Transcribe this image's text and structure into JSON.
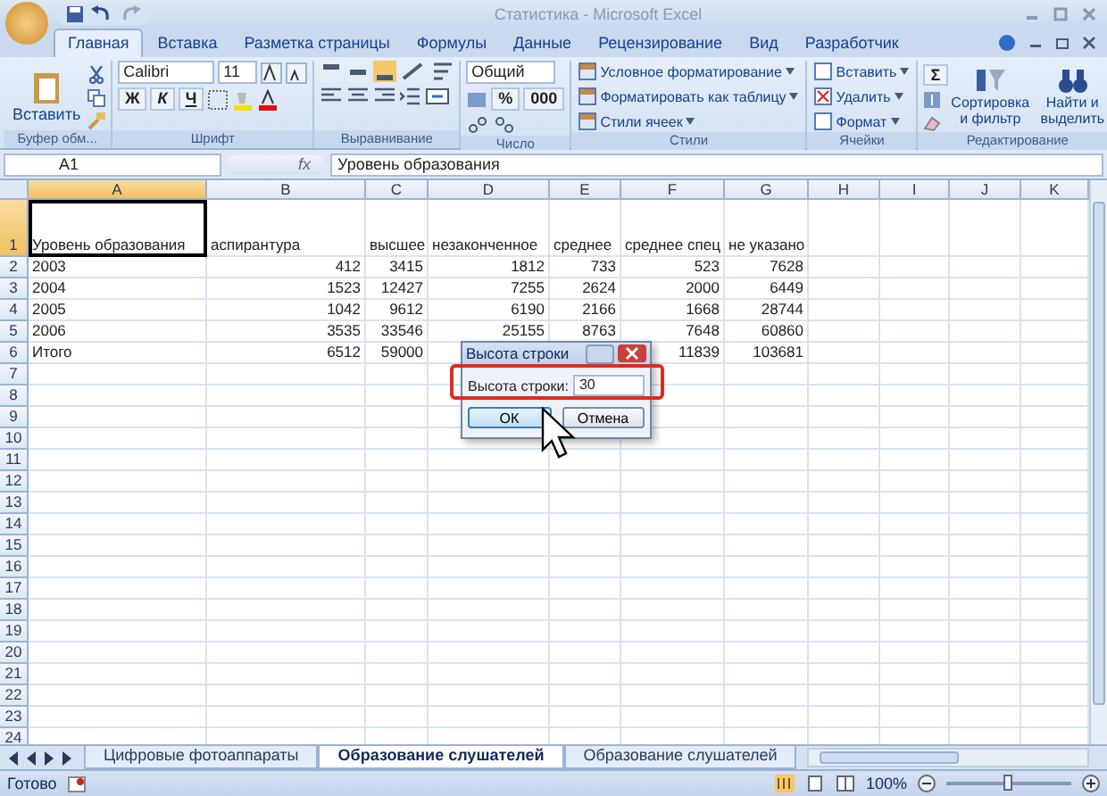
{
  "window": {
    "title": "Статистика - Microsoft Excel"
  },
  "ribbon_tabs": [
    {
      "label": "Главная",
      "selected": true
    },
    {
      "label": "Вставка",
      "selected": false
    },
    {
      "label": "Разметка страницы",
      "selected": false
    },
    {
      "label": "Формулы",
      "selected": false
    },
    {
      "label": "Данные",
      "selected": false
    },
    {
      "label": "Рецензирование",
      "selected": false
    },
    {
      "label": "Вид",
      "selected": false
    },
    {
      "label": "Разработчик",
      "selected": false
    }
  ],
  "ribbon": {
    "clipboard": {
      "paste": "Вставить",
      "label": "Буфер обм..."
    },
    "font": {
      "name": "Calibri",
      "size": "11",
      "styles": [
        "Ж",
        "К",
        "Ч"
      ],
      "label": "Шрифт"
    },
    "alignment": {
      "label": "Выравнивание"
    },
    "number": {
      "format": "Общий",
      "symbols": [
        "%",
        "000"
      ],
      "label": "Число"
    },
    "styles": {
      "items": [
        "Условное форматирование",
        "Форматировать как таблицу",
        "Стили ячеек"
      ],
      "label": "Стили"
    },
    "cells": {
      "items": [
        "Вставить",
        "Удалить",
        "Формат"
      ],
      "label": "Ячейки"
    },
    "editing": {
      "sigma": "Σ",
      "buttons": [
        "Сортировка и фильтр",
        "Найти и выделить"
      ],
      "label": "Редактирование"
    }
  },
  "formula_bar": {
    "name_box": "A1",
    "fx": "fx",
    "value": "Уровень образования"
  },
  "sheet": {
    "columns": [
      "A",
      "B",
      "C",
      "D",
      "E",
      "F",
      "G",
      "H",
      "I",
      "J",
      "K"
    ],
    "rows": [
      {
        "label": "1",
        "cells": [
          "Уровень образования",
          "аспирантура",
          "высшее",
          "незаконченное",
          "среднее",
          "среднее спец",
          "не указано"
        ]
      },
      {
        "label": "2",
        "cells": [
          "2003",
          "412",
          "3415",
          "1812",
          "733",
          "523",
          "7628"
        ]
      },
      {
        "label": "3",
        "cells": [
          "2004",
          "1523",
          "12427",
          "7255",
          "2624",
          "2000",
          "6449"
        ]
      },
      {
        "label": "4",
        "cells": [
          "2005",
          "1042",
          "9612",
          "6190",
          "2166",
          "1668",
          "28744"
        ]
      },
      {
        "label": "5",
        "cells": [
          "2006",
          "3535",
          "33546",
          "25155",
          "8763",
          "7648",
          "60860"
        ]
      },
      {
        "label": "6",
        "cells": [
          "Итого",
          "6512",
          "59000",
          null,
          null,
          "11839",
          "103681"
        ]
      },
      {
        "label": "7"
      },
      {
        "label": "8"
      },
      {
        "label": "9"
      },
      {
        "label": "10"
      },
      {
        "label": "11"
      },
      {
        "label": "12"
      },
      {
        "label": "13"
      },
      {
        "label": "14"
      },
      {
        "label": "15"
      },
      {
        "label": "16"
      },
      {
        "label": "17"
      },
      {
        "label": "18"
      },
      {
        "label": "19"
      },
      {
        "label": "20"
      },
      {
        "label": "21"
      },
      {
        "label": "22"
      },
      {
        "label": "23"
      },
      {
        "label": "24"
      }
    ]
  },
  "dialog": {
    "title": "Высота строки",
    "field_label": "Высота строки:",
    "value": "30",
    "buttons": [
      "ОК",
      "Отмена"
    ]
  },
  "sheet_tabs": [
    {
      "label": "Цифровые фотоаппараты",
      "selected": false
    },
    {
      "label": "Образование слушателей",
      "selected": true
    },
    {
      "label": "Образование слушателей",
      "selected": false
    }
  ],
  "status_bar": {
    "status": "Готово",
    "zoom": "100%",
    "zoom_slider": {
      "level": 0.5
    }
  }
}
